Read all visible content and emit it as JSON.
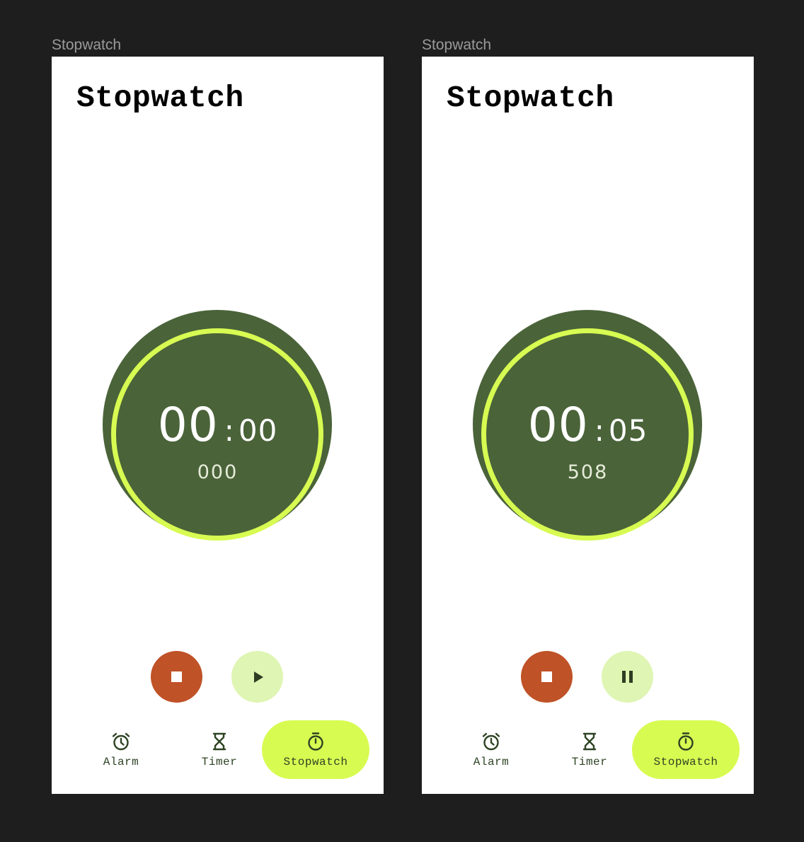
{
  "frames": [
    {
      "label": "Stopwatch",
      "title": "Stopwatch",
      "time": {
        "minutes": "00",
        "colon": ":",
        "seconds": "00",
        "milliseconds": "000"
      },
      "controls": {
        "stop_icon": "stop-icon",
        "toggle_icon": "play-icon"
      },
      "nav": [
        {
          "label": "Alarm",
          "icon": "alarm-icon"
        },
        {
          "label": "Timer",
          "icon": "hourglass-icon"
        },
        {
          "label": "Stopwatch",
          "icon": "stopwatch-icon",
          "active": true
        }
      ]
    },
    {
      "label": "Stopwatch",
      "title": "Stopwatch",
      "time": {
        "minutes": "00",
        "colon": ":",
        "seconds": "05",
        "milliseconds": "508"
      },
      "controls": {
        "stop_icon": "stop-icon",
        "toggle_icon": "pause-icon"
      },
      "nav": [
        {
          "label": "Alarm",
          "icon": "alarm-icon"
        },
        {
          "label": "Timer",
          "icon": "hourglass-icon"
        },
        {
          "label": "Stopwatch",
          "icon": "stopwatch-icon",
          "active": true
        }
      ]
    }
  ],
  "colors": {
    "background": "#1e1e1e",
    "screen": "#ffffff",
    "dial": "#4a6339",
    "ring": "#d8fb52",
    "stop_button": "#bf5227",
    "toggle_button": "#dff5b3",
    "nav_active": "#d8fb52",
    "nav_text": "#2e4323"
  }
}
